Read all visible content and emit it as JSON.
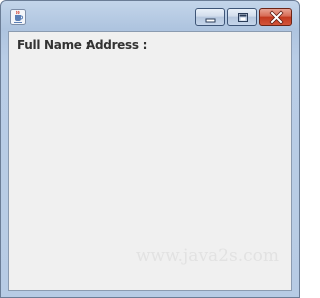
{
  "window": {
    "controls": {
      "minimize_icon": "minimize-icon",
      "maximize_icon": "maximize-icon",
      "close_icon": "close-icon"
    },
    "app_icon": "java-cup-icon"
  },
  "content": {
    "full_name_label": "Full Name :",
    "address_label": "Address :"
  },
  "watermark": "www.java2s.com",
  "colors": {
    "frame": "#b9cde6",
    "client_bg": "#f0f0f0",
    "close_button": "#c2391f",
    "label_text": "#333333"
  }
}
